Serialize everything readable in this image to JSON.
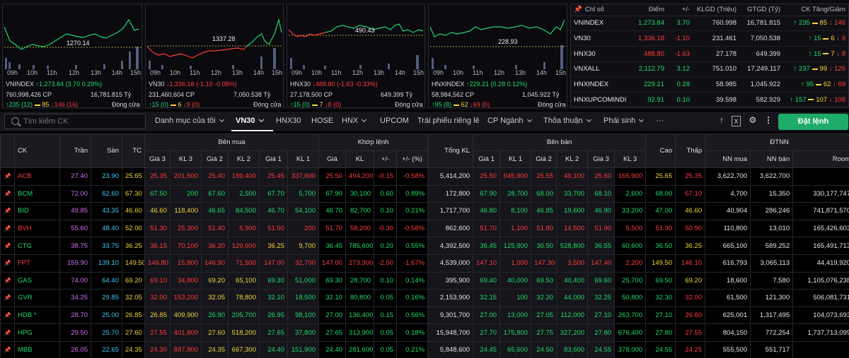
{
  "minis": [
    {
      "name": "VNINDEX",
      "ref": "1270.14",
      "axis": [
        "09h",
        "10h",
        "11h",
        "12h",
        "13h",
        "14h",
        "15h"
      ],
      "line1_name": "VNINDEX",
      "line1_change": "↑1,273.84 (3.70 0.29%)",
      "line2_vol": "760,998,426 CP",
      "line2_val": "16,781.815 Tỷ",
      "up": "↑235 (12)",
      "ref_count": "85",
      "dn": "↓146 (16)",
      "status": "Đóng cửa"
    },
    {
      "name": "VN30",
      "ref": "1337.28",
      "axis": [
        "09h",
        "10h",
        "11h",
        "12h",
        "13h",
        "14h",
        "15h"
      ],
      "line1_name": "VN30",
      "line1_change": "↓1,336.18 (-1.10 -0.08%)",
      "line2_vol": "231,460,604 CP",
      "line2_val": "7,050.538 Tỷ",
      "up": "↑15 (0)",
      "ref_count": "6",
      "dn": "↓9 (0)",
      "status": "Đóng cửa"
    },
    {
      "name": "HNX30",
      "ref": "490.43",
      "axis": [
        "09h",
        "10h",
        "11h",
        "12h",
        "13h",
        "14h",
        "15h"
      ],
      "line1_name": "HNX30",
      "line1_change": "↓488.80 (-1.63 -0.33%)",
      "line2_vol": "27,178,500 CP",
      "line2_val": "649.399 Tỷ",
      "up": "↑15 (0)",
      "ref_count": "7",
      "dn": "↓8 (0)",
      "status": "Đóng cửa"
    },
    {
      "name": "HNXINDEX",
      "ref": "228.93",
      "axis": [
        "09h",
        "10h",
        "11h",
        "12h",
        "13h",
        "14h",
        "15h"
      ],
      "line1_name": "HNXINDEX",
      "line1_change": "↑229.21 (0.28 0.12%)",
      "line2_vol": "58,984,562 CP",
      "line2_val": "1,045.922 Tỷ",
      "up": "↑95 (8)",
      "ref_count": "62",
      "dn": "↓69 (0)",
      "status": "Đóng cửa"
    }
  ],
  "overview": {
    "headers": [
      "Chỉ số",
      "Điểm",
      "+/-",
      "KLGD (Triệu)",
      "GTGD (Tỷ)",
      "CK Tăng/Giảm"
    ],
    "rows": [
      {
        "name": "VNINDEX",
        "point": "1,273.84",
        "chg": "3.70",
        "vol": "760.998",
        "val": "16,781.815",
        "up": "↑ 235",
        "ref": "85",
        "dn": "↓ 146",
        "cls": "up"
      },
      {
        "name": "VN30",
        "point": "1,336.18",
        "chg": "-1.10",
        "vol": "231.461",
        "val": "7,050.538",
        "up": "↑ 15",
        "ref": "6",
        "dn": "↓ 9",
        "cls": "dn"
      },
      {
        "name": "HNX30",
        "point": "488.80",
        "chg": "-1.63",
        "vol": "27.178",
        "val": "649.399",
        "up": "↑ 15",
        "ref": "7",
        "dn": "↓ 8",
        "cls": "dn"
      },
      {
        "name": "VNXALL",
        "point": "2,112.79",
        "chg": "3.12",
        "vol": "751.010",
        "val": "17,249.117",
        "up": "↑ 237",
        "ref": "99",
        "dn": "↓ 126",
        "cls": "up"
      },
      {
        "name": "HNXINDEX",
        "point": "229.21",
        "chg": "0.28",
        "vol": "58.985",
        "val": "1,045.922",
        "up": "↑ 95",
        "ref": "62",
        "dn": "↓ 69",
        "cls": "up"
      },
      {
        "name": "HNXUPCOMINDI",
        "point": "92.91",
        "chg": "0.10",
        "vol": "39.598",
        "val": "582.929",
        "up": "↑ 157",
        "ref": "107",
        "dn": "↓ 108",
        "cls": "up"
      }
    ]
  },
  "toolbar": {
    "search_placeholder": "Tìm kiếm CK",
    "tabs": [
      "Danh mục của tôi",
      "VN30",
      "HNX30",
      "HOSE",
      "HNX",
      "UPCOM",
      "Trái phiếu riêng lẻ",
      "CP Ngành",
      "Thỏa thuận",
      "Phái sinh",
      "···"
    ],
    "order_label": "Đặt lệnh"
  },
  "board": {
    "group_headers": [
      "Bên mua",
      "Khớp lệnh",
      "Bên bán",
      "ĐTNN"
    ],
    "headers": [
      "CK",
      "Trần",
      "Sàn",
      "TC",
      "Giá 3",
      "KL 3",
      "Giá 2",
      "KL 2",
      "Giá 1",
      "KL 1",
      "Giá",
      "KL",
      "+/-",
      "+/- (%)",
      "Tổng KL",
      "Giá 1",
      "KL 1",
      "Giá 2",
      "KL 2",
      "Giá 3",
      "KL 3",
      "Cao",
      "Thấp",
      "NN mua",
      "NN bán",
      "Room"
    ],
    "rows": [
      {
        "c": [
          "ACB",
          "27.40",
          "23.90",
          "25.65",
          "25.35",
          "201,500",
          "25.40",
          "189,400",
          "25.45",
          "337,600",
          "25.50",
          "494,200",
          "-0.15",
          "-0.58%",
          "5,414,200",
          "25.50",
          "645,900",
          "25.55",
          "49,100",
          "25.60",
          "165,900",
          "25.65",
          "25.35",
          "3,622,700",
          "3,622,700",
          ""
        ],
        "k": [
          "dn",
          "ce",
          "fl",
          "ref",
          "dn",
          "dn",
          "dn",
          "dn",
          "dn",
          "dn",
          "dn",
          "dn",
          "dn",
          "dn",
          "w",
          "dn",
          "dn",
          "dn",
          "dn",
          "dn",
          "dn",
          "ref",
          "dn",
          "w",
          "w",
          "w"
        ]
      },
      {
        "c": [
          "BCM",
          "72.00",
          "62.60",
          "67.30",
          "67.50",
          "200",
          "67.60",
          "2,500",
          "67.70",
          "5,700",
          "67.90",
          "30,100",
          "0.60",
          "0.89%",
          "172,800",
          "67.90",
          "28,700",
          "68.00",
          "33,700",
          "68.10",
          "2,600",
          "68.00",
          "67.10",
          "4,700",
          "15,350",
          "330,177,747"
        ],
        "k": [
          "up",
          "ce",
          "fl",
          "ref",
          "up",
          "up",
          "up",
          "up",
          "up",
          "up",
          "up",
          "up",
          "up",
          "up",
          "w",
          "up",
          "up",
          "up",
          "up",
          "up",
          "up",
          "up",
          "dn",
          "w",
          "w",
          "w"
        ]
      },
      {
        "c": [
          "BID",
          "49.85",
          "43.35",
          "46.60",
          "46.60",
          "118,400",
          "46.65",
          "84,500",
          "46.70",
          "54,100",
          "46.70",
          "82,700",
          "0.10",
          "0.21%",
          "1,717,700",
          "46.80",
          "8,100",
          "46.85",
          "19,600",
          "46.90",
          "33,200",
          "47.00",
          "46.60",
          "40,904",
          "286,246",
          "741,871,570"
        ],
        "k": [
          "up",
          "ce",
          "fl",
          "ref",
          "ref",
          "ref",
          "up",
          "up",
          "up",
          "up",
          "up",
          "up",
          "up",
          "up",
          "w",
          "up",
          "up",
          "up",
          "up",
          "up",
          "up",
          "up",
          "ref",
          "w",
          "w",
          "w"
        ]
      },
      {
        "c": [
          "BVH",
          "55.60",
          "48.40",
          "52.00",
          "51.30",
          "25,300",
          "51.40",
          "5,900",
          "51.50",
          "200",
          "51.70",
          "58,200",
          "-0.30",
          "-0.58%",
          "862,600",
          "51.70",
          "1,100",
          "51.80",
          "14,500",
          "51.90",
          "5,500",
          "51.90",
          "50.90",
          "110,800",
          "13,010",
          "165,426,603"
        ],
        "k": [
          "dn",
          "ce",
          "fl",
          "ref",
          "dn",
          "dn",
          "dn",
          "dn",
          "dn",
          "dn",
          "dn",
          "dn",
          "dn",
          "dn",
          "w",
          "dn",
          "dn",
          "dn",
          "dn",
          "dn",
          "dn",
          "dn",
          "dn",
          "w",
          "w",
          "w"
        ]
      },
      {
        "c": [
          "CTG",
          "38.75",
          "33.75",
          "36.25",
          "36.15",
          "70,100",
          "36.20",
          "129,600",
          "36.25",
          "9,700",
          "36.45",
          "785,600",
          "0.20",
          "0.55%",
          "4,392,500",
          "36.45",
          "125,800",
          "36.50",
          "528,800",
          "36.55",
          "60,600",
          "36.50",
          "36.25",
          "665,100",
          "589,252",
          "165,491,713"
        ],
        "k": [
          "up",
          "ce",
          "fl",
          "ref",
          "dn",
          "dn",
          "dn",
          "dn",
          "ref",
          "ref",
          "up",
          "up",
          "up",
          "up",
          "w",
          "up",
          "up",
          "up",
          "up",
          "up",
          "up",
          "up",
          "ref",
          "w",
          "w",
          "w"
        ]
      },
      {
        "c": [
          "FPT",
          "159.90",
          "139.10",
          "149.50",
          "146.80",
          "15,800",
          "146.90",
          "71,500",
          "147.00",
          "32,700",
          "147.00",
          "273,300",
          "-2.50",
          "-1.67%",
          "4,539,000",
          "147.10",
          "1,000",
          "147.30",
          "3,500",
          "147.40",
          "2,200",
          "149.50",
          "146.10",
          "616,793",
          "3,065,113",
          "44,419,920"
        ],
        "k": [
          "dn",
          "ce",
          "fl",
          "ref",
          "dn",
          "dn",
          "dn",
          "dn",
          "dn",
          "dn",
          "dn",
          "dn",
          "dn",
          "dn",
          "w",
          "dn",
          "dn",
          "dn",
          "dn",
          "dn",
          "dn",
          "ref",
          "dn",
          "w",
          "w",
          "w"
        ]
      },
      {
        "c": [
          "GAS",
          "74.00",
          "64.40",
          "69.20",
          "69.10",
          "34,800",
          "69.20",
          "65,100",
          "69.30",
          "51,000",
          "69.30",
          "28,700",
          "0.10",
          "0.14%",
          "395,900",
          "69.40",
          "40,000",
          "69.50",
          "40,400",
          "69.60",
          "25,700",
          "69.50",
          "69.20",
          "18,600",
          "7,580",
          "1,105,076,238"
        ],
        "k": [
          "up",
          "ce",
          "fl",
          "ref",
          "dn",
          "dn",
          "ref",
          "ref",
          "up",
          "up",
          "up",
          "up",
          "up",
          "up",
          "w",
          "up",
          "up",
          "up",
          "up",
          "up",
          "up",
          "up",
          "ref",
          "w",
          "w",
          "w"
        ]
      },
      {
        "c": [
          "GVR",
          "34.25",
          "29.85",
          "32.05",
          "32.00",
          "153,200",
          "32.05",
          "78,800",
          "32.10",
          "18,500",
          "32.10",
          "80,800",
          "0.05",
          "0.16%",
          "2,153,900",
          "32.15",
          "100",
          "32.20",
          "44,000",
          "32.25",
          "50,800",
          "32.30",
          "32.00",
          "61,500",
          "121,300",
          "506,081,731"
        ],
        "k": [
          "up",
          "ce",
          "fl",
          "ref",
          "dn",
          "dn",
          "ref",
          "ref",
          "up",
          "up",
          "up",
          "up",
          "up",
          "up",
          "w",
          "up",
          "up",
          "up",
          "up",
          "up",
          "up",
          "up",
          "dn",
          "w",
          "w",
          "w"
        ]
      },
      {
        "c": [
          "HDB *",
          "28.70",
          "25.00",
          "26.85",
          "26.85",
          "409,900",
          "26.90",
          "205,700",
          "26.95",
          "98,100",
          "27.00",
          "136,400",
          "0.15",
          "0.56%",
          "9,301,700",
          "27.00",
          "13,000",
          "27.05",
          "112,000",
          "27.10",
          "263,700",
          "27.10",
          "26.80",
          "625,001",
          "1,317,495",
          "104,073,693"
        ],
        "k": [
          "up",
          "ce",
          "fl",
          "ref",
          "ref",
          "ref",
          "up",
          "up",
          "up",
          "up",
          "up",
          "up",
          "up",
          "up",
          "w",
          "up",
          "up",
          "up",
          "up",
          "up",
          "up",
          "up",
          "dn",
          "w",
          "w",
          "w"
        ]
      },
      {
        "c": [
          "HPG",
          "29.50",
          "25.70",
          "27.60",
          "27.55",
          "401,800",
          "27.60",
          "518,200",
          "27.65",
          "37,800",
          "27.65",
          "313,900",
          "0.05",
          "0.18%",
          "15,948,700",
          "27.70",
          "175,800",
          "27.75",
          "327,200",
          "27.80",
          "676,400",
          "27.80",
          "27.55",
          "804,150",
          "772,254",
          "1,737,713,099"
        ],
        "k": [
          "up",
          "ce",
          "fl",
          "ref",
          "dn",
          "dn",
          "ref",
          "ref",
          "up",
          "up",
          "up",
          "up",
          "up",
          "up",
          "w",
          "up",
          "up",
          "up",
          "up",
          "up",
          "up",
          "up",
          "dn",
          "w",
          "w",
          "w"
        ]
      },
      {
        "c": [
          "MBB",
          "26.05",
          "22.65",
          "24.35",
          "24.30",
          "887,800",
          "24.35",
          "667,300",
          "24.40",
          "151,900",
          "24.40",
          "281,600",
          "0.05",
          "0.21%",
          "5,848,600",
          "24.45",
          "65,600",
          "24.50",
          "83,600",
          "24.55",
          "378,000",
          "24.55",
          "24.25",
          "555,500",
          "551,717",
          ""
        ],
        "k": [
          "up",
          "ce",
          "fl",
          "ref",
          "dn",
          "dn",
          "ref",
          "ref",
          "up",
          "up",
          "up",
          "up",
          "up",
          "up",
          "w",
          "up",
          "up",
          "up",
          "up",
          "up",
          "up",
          "up",
          "dn",
          "w",
          "w",
          "w"
        ]
      }
    ]
  }
}
